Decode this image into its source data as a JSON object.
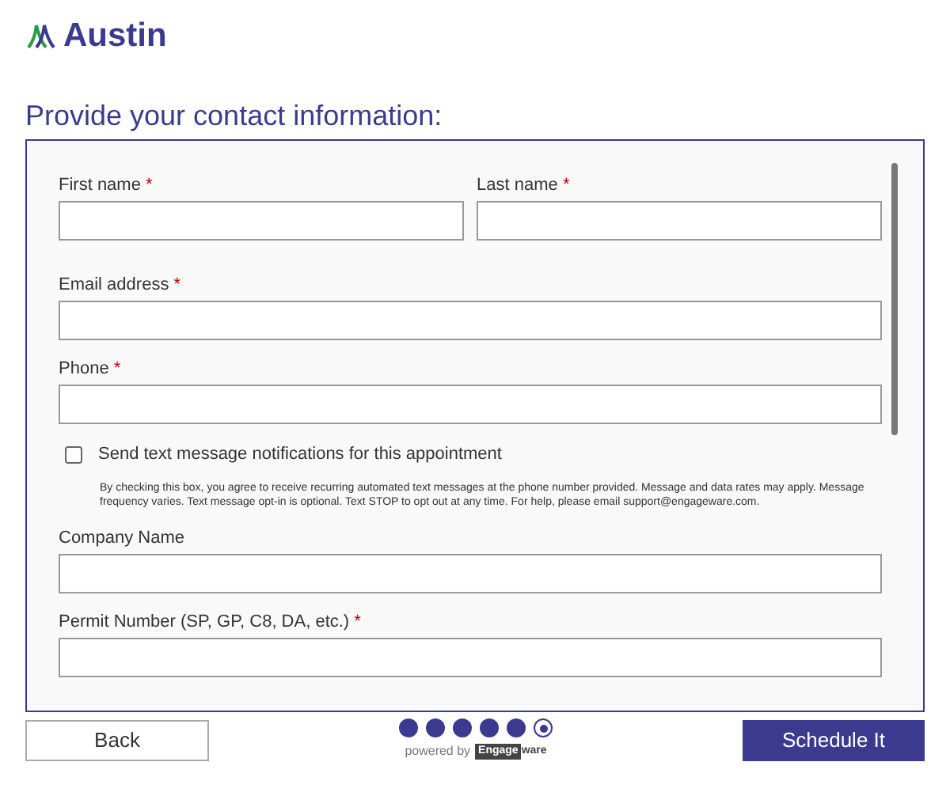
{
  "logo": {
    "text": "Austin"
  },
  "title": "Provide your contact information:",
  "required_mark": "*",
  "fields": [
    {
      "kind": "field",
      "label": "First name",
      "required": true,
      "half": true
    },
    {
      "kind": "field",
      "label": "Last name",
      "required": true,
      "half": true
    },
    {
      "kind": "field",
      "label": "Email address",
      "required": true,
      "half": false
    },
    {
      "kind": "field",
      "label": "Phone",
      "required": true,
      "half": false
    },
    {
      "kind": "checkbox",
      "label": "Send text message notifications for this appointment",
      "checked": false,
      "note": "By checking this box, you agree to receive recurring automated text messages at the phone number provided. Message and data rates may apply. Message frequency varies. Text message opt-in is optional. Text STOP to opt out at any time. For help, please email support@engageware.com."
    },
    {
      "kind": "field",
      "label": "Company Name",
      "required": false,
      "half": false
    },
    {
      "kind": "field",
      "label": "Permit Number (SP, GP, C8, DA, etc.)",
      "required": true,
      "half": false
    }
  ],
  "back_button": "Back",
  "steps": [
    {
      "selected": false
    },
    {
      "selected": false
    },
    {
      "selected": false
    },
    {
      "selected": false
    },
    {
      "selected": false
    },
    {
      "selected": true
    }
  ],
  "powered_by": {
    "prefix": "powered by",
    "brand_badge": "Engage",
    "brand_rest": "ware"
  },
  "submit_button": "Schedule It"
}
